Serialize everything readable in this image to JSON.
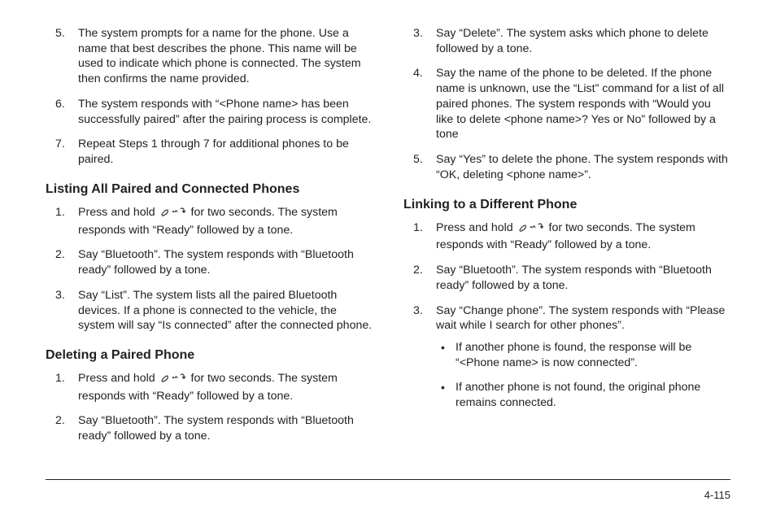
{
  "left": {
    "top_items": [
      {
        "n": "5.",
        "t": "The system prompts for a name for the phone. Use a name that best describes the phone. This name will be used to indicate which phone is connected. The system then confirms the name provided."
      },
      {
        "n": "6.",
        "t": "The system responds with “<Phone name> has been successfully paired” after the pairing process is complete."
      },
      {
        "n": "7.",
        "t": "Repeat Steps 1 through 7 for additional phones to be paired."
      }
    ],
    "h1": "Listing All Paired and Connected Phones",
    "list1": [
      {
        "n": "1.",
        "pre": "Press and hold ",
        "post": " for two seconds. The system responds with “Ready” followed by a tone.",
        "icon": true
      },
      {
        "n": "2.",
        "t": "Say “Bluetooth”. The system responds with “Bluetooth ready” followed by a tone."
      },
      {
        "n": "3.",
        "t": "Say “List”. The system lists all the paired Bluetooth devices. If a phone is connected to the vehicle, the system will say “Is connected” after the connected phone."
      }
    ],
    "h2": "Deleting a Paired Phone",
    "list2": [
      {
        "n": "1.",
        "pre": "Press and hold ",
        "post": " for two seconds. The system responds with “Ready” followed by a tone.",
        "icon": true
      },
      {
        "n": "2.",
        "t": "Say “Bluetooth”. The system responds with “Bluetooth ready” followed by a tone."
      }
    ]
  },
  "right": {
    "top_items": [
      {
        "n": "3.",
        "t": "Say “Delete”. The system asks which phone to delete followed by a tone."
      },
      {
        "n": "4.",
        "t": "Say the name of the phone to be deleted. If the phone name is unknown, use the “List” command for a list of all paired phones. The system responds with “Would you like to delete <phone name>? Yes or No” followed by a tone"
      },
      {
        "n": "5.",
        "t": "Say “Yes” to delete the phone. The system responds with “OK, deleting <phone name>”."
      }
    ],
    "h1": "Linking to a Different Phone",
    "list1": [
      {
        "n": "1.",
        "pre": "Press and hold ",
        "post": " for two seconds. The system responds with “Ready” followed by a tone.",
        "icon": true
      },
      {
        "n": "2.",
        "t": "Say “Bluetooth”. The system responds with “Bluetooth ready” followed by a tone."
      },
      {
        "n": "3.",
        "t": "Say “Change phone”. The system responds with “Please wait while I search for other phones”.",
        "sub": [
          "If another phone is found, the response will be “<Phone name> is now connected”.",
          "If another phone is not found, the original phone remains connected."
        ]
      }
    ]
  },
  "page_number": "4-115"
}
